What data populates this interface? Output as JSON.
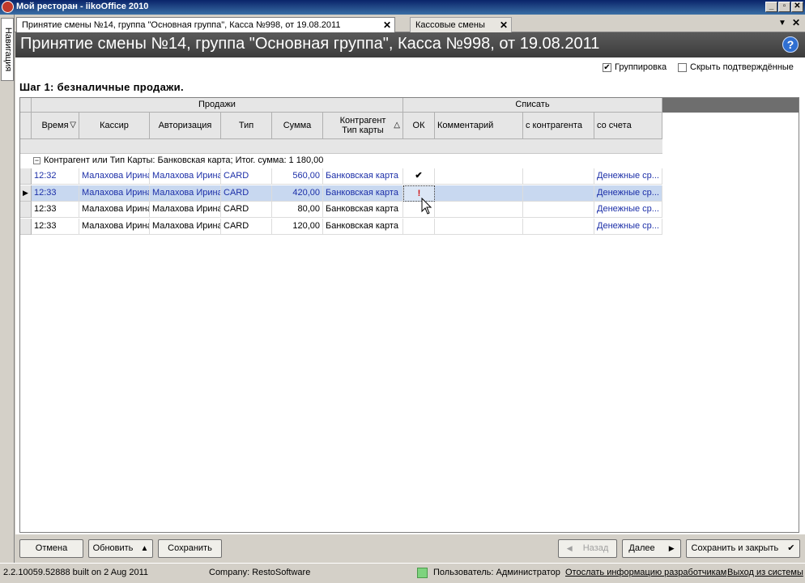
{
  "window": {
    "title": "Мой ресторан - iikoOffice 2010",
    "btn_min": "_",
    "btn_max": "▫",
    "btn_close": "✕"
  },
  "nav": {
    "label": "Навигация"
  },
  "tabs": [
    {
      "label": "Принятие смены №14, группа \"Основная группа\", Касса №998, от 19.08.2011",
      "close": "✕"
    },
    {
      "label": "Кассовые смены",
      "close": "✕"
    }
  ],
  "tabbar": {
    "dropdown": "▼",
    "close": "✕"
  },
  "page": {
    "header": "Принятие смены №14, группа \"Основная группа\", Касса №998, от 19.08.2011",
    "help": "?"
  },
  "options": {
    "grouping": {
      "label": "Группировка",
      "checked": "✔"
    },
    "hide_confirmed": {
      "label": "Скрыть подтверждённые",
      "checked": ""
    }
  },
  "step": "Шаг 1: безналичные продажи.",
  "grid": {
    "bands": {
      "sales": "Продажи",
      "writeoff": "Списать"
    },
    "columns": {
      "time": "Время",
      "cashier": "Кассир",
      "auth": "Авторизация",
      "type": "Тип",
      "sum": "Сумма",
      "contractor_line1": "Контрагент",
      "contractor_line2": "Тип карты",
      "ok": "ОК",
      "comment": "Комментарий",
      "with_contractor": "с контрагента",
      "from_account": "со счета"
    },
    "sort_icons": {
      "time": "▽",
      "contractor": "△"
    },
    "group": {
      "expander": "−",
      "label": "Контрагент или Тип Карты: Банковская карта; Итог. сумма: 1 180,00"
    },
    "rows": [
      {
        "time": "12:32",
        "cashier": "Малахова Ирина",
        "auth": "Малахова Ирина",
        "type": "CARD",
        "sum": "560,00",
        "card": "Банковская карта",
        "ok": "✔",
        "comment": "",
        "with_contractor": "",
        "from_account": "Денежные ср...",
        "indicator": ""
      },
      {
        "time": "12:33",
        "cashier": "Малахова Ирина",
        "auth": "Малахова Ирина",
        "type": "CARD",
        "sum": "420,00",
        "card": "Банковская карта",
        "ok": "!",
        "comment": "",
        "with_contractor": "",
        "from_account": "Денежные ср...",
        "indicator": "▶"
      },
      {
        "time": "12:33",
        "cashier": "Малахова Ирина",
        "auth": "Малахова Ирина",
        "type": "CARD",
        "sum": "80,00",
        "card": "Банковская карта",
        "ok": "",
        "comment": "",
        "with_contractor": "",
        "from_account": "Денежные ср...",
        "indicator": ""
      },
      {
        "time": "12:33",
        "cashier": "Малахова Ирина",
        "auth": "Малахова Ирина",
        "type": "CARD",
        "sum": "120,00",
        "card": "Банковская карта",
        "ok": "",
        "comment": "",
        "with_contractor": "",
        "from_account": "Денежные ср...",
        "indicator": ""
      }
    ]
  },
  "buttons": {
    "cancel": "Отмена",
    "refresh": "Обновить",
    "refresh_icon": "▲",
    "save": "Сохранить",
    "back": "Назад",
    "back_icon": "◀",
    "next": "Далее",
    "next_icon": "▶",
    "save_close": "Сохранить и закрыть",
    "save_close_icon": "✔"
  },
  "status": {
    "build": "2.2.10059.52888 built on 2 Aug 2011",
    "company": "Company: RestoSoftware",
    "user": "Пользователь: Администратор",
    "send_info": "Отослать информацию разработчикам",
    "logout": "Выход из системы"
  },
  "colors": {
    "selected_row": "#c8d8f0",
    "link_blue": "#1c2fa8",
    "ok_mark_red": "#d01010"
  }
}
